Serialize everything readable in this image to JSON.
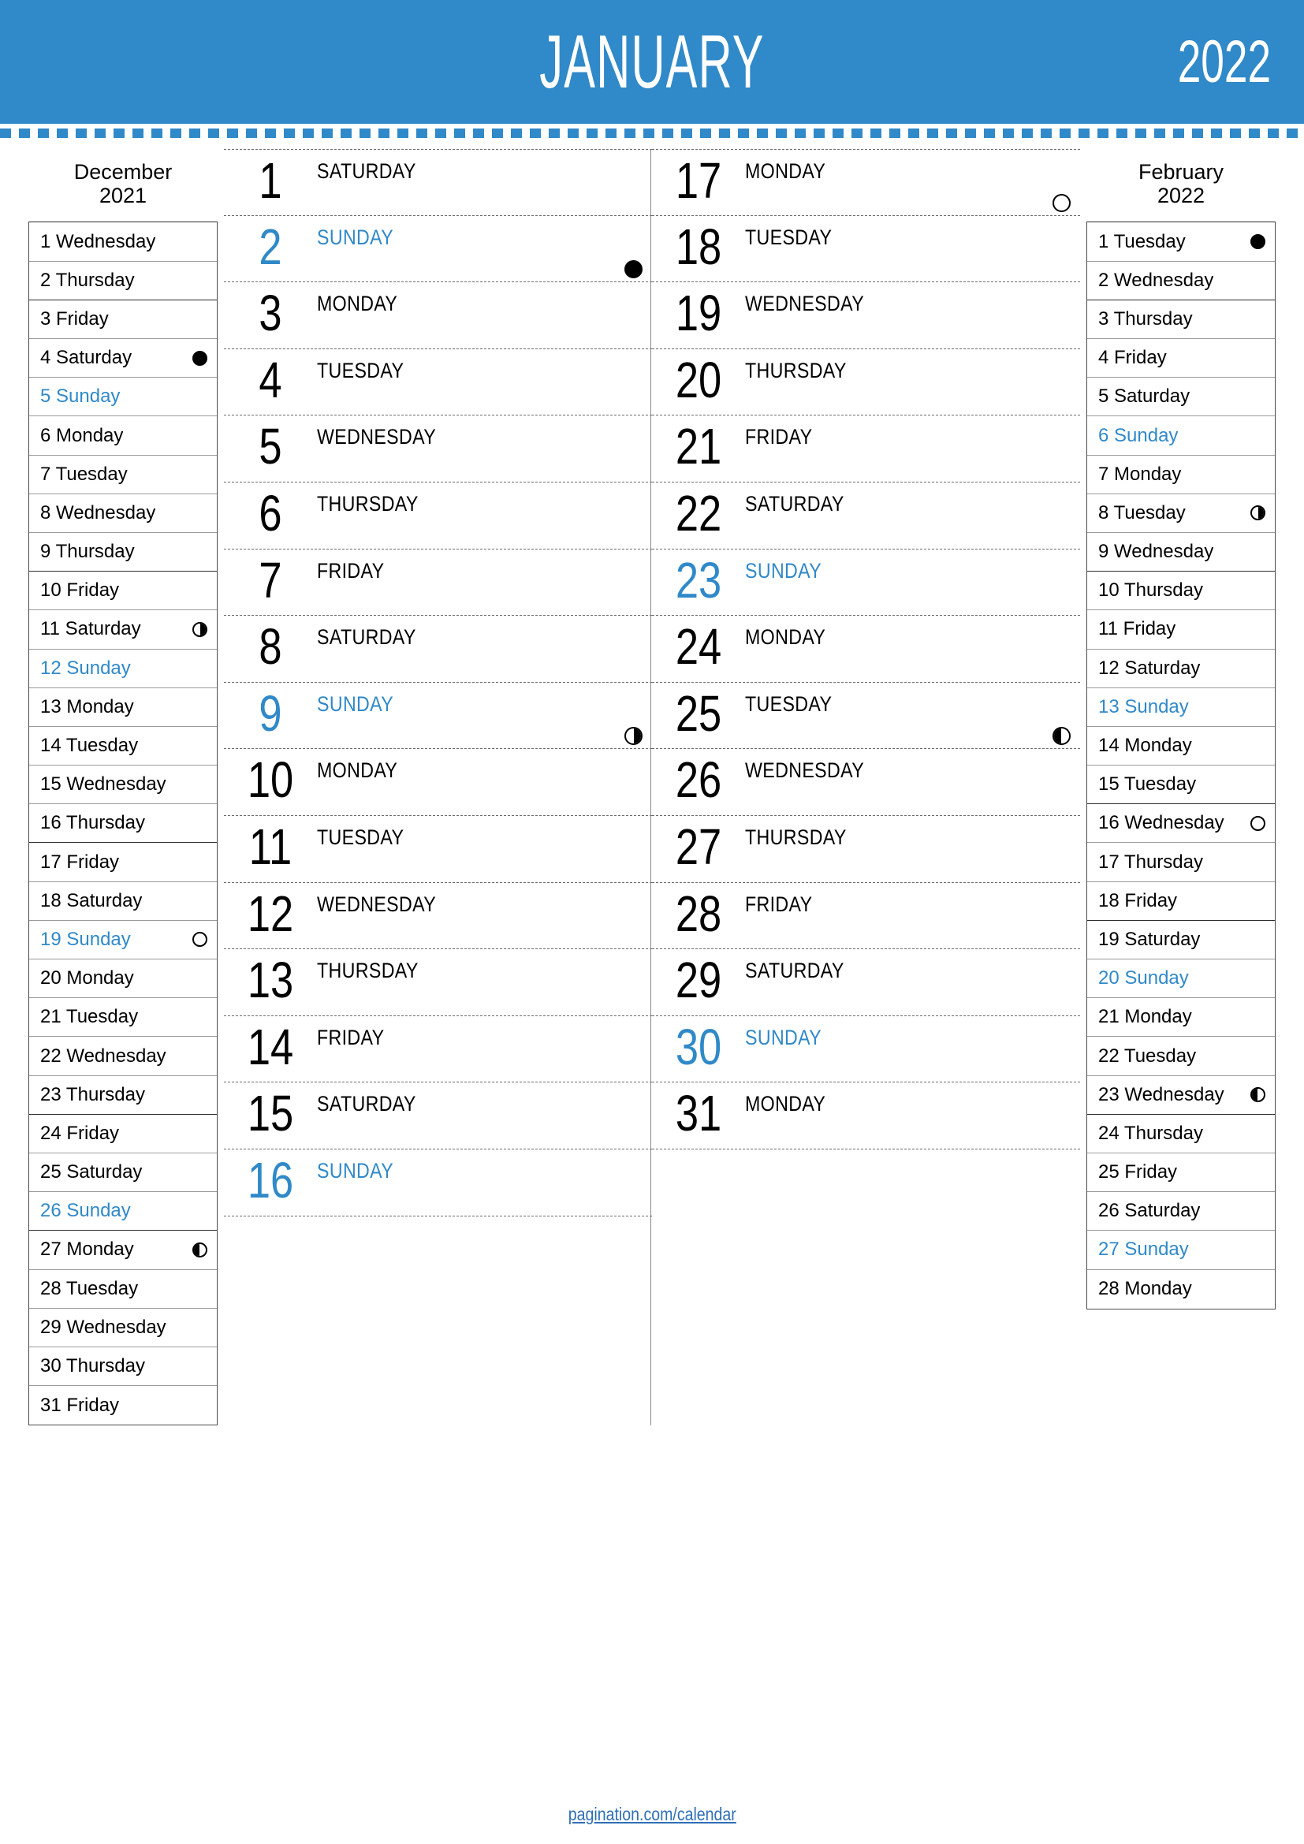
{
  "header": {
    "month": "JANUARY",
    "year": "2022",
    "accent_color": "#3089c8"
  },
  "footer": {
    "link_text": "pagination.com/calendar",
    "link_color": "#2f6fb5"
  },
  "moon_legend": {
    "new": "new-moon",
    "first": "first-quarter-moon",
    "full": "full-moon",
    "last": "last-quarter-moon"
  },
  "prev_month": {
    "name": "December",
    "year": "2021",
    "days": [
      {
        "num": "1",
        "weekday": "Wednesday",
        "label": "1 Wednesday",
        "sunday": false,
        "moon": "none",
        "week_end": false
      },
      {
        "num": "2",
        "weekday": "Thursday",
        "label": "2 Thursday",
        "sunday": false,
        "moon": "none",
        "week_end": true
      },
      {
        "num": "3",
        "weekday": "Friday",
        "label": "3 Friday",
        "sunday": false,
        "moon": "none",
        "week_end": false
      },
      {
        "num": "4",
        "weekday": "Saturday",
        "label": "4 Saturday",
        "sunday": false,
        "moon": "new",
        "week_end": false
      },
      {
        "num": "5",
        "weekday": "Sunday",
        "label": "5 Sunday",
        "sunday": true,
        "moon": "none",
        "week_end": false
      },
      {
        "num": "6",
        "weekday": "Monday",
        "label": "6 Monday",
        "sunday": false,
        "moon": "none",
        "week_end": false
      },
      {
        "num": "7",
        "weekday": "Tuesday",
        "label": "7 Tuesday",
        "sunday": false,
        "moon": "none",
        "week_end": false
      },
      {
        "num": "8",
        "weekday": "Wednesday",
        "label": "8 Wednesday",
        "sunday": false,
        "moon": "none",
        "week_end": false
      },
      {
        "num": "9",
        "weekday": "Thursday",
        "label": "9 Thursday",
        "sunday": false,
        "moon": "none",
        "week_end": true
      },
      {
        "num": "10",
        "weekday": "Friday",
        "label": "10 Friday",
        "sunday": false,
        "moon": "none",
        "week_end": false
      },
      {
        "num": "11",
        "weekday": "Saturday",
        "label": "11 Saturday",
        "sunday": false,
        "moon": "first",
        "week_end": false
      },
      {
        "num": "12",
        "weekday": "Sunday",
        "label": "12 Sunday",
        "sunday": true,
        "moon": "none",
        "week_end": false
      },
      {
        "num": "13",
        "weekday": "Monday",
        "label": "13 Monday",
        "sunday": false,
        "moon": "none",
        "week_end": false
      },
      {
        "num": "14",
        "weekday": "Tuesday",
        "label": "14 Tuesday",
        "sunday": false,
        "moon": "none",
        "week_end": false
      },
      {
        "num": "15",
        "weekday": "Wednesday",
        "label": "15 Wednesday",
        "sunday": false,
        "moon": "none",
        "week_end": false
      },
      {
        "num": "16",
        "weekday": "Thursday",
        "label": "16 Thursday",
        "sunday": false,
        "moon": "none",
        "week_end": true
      },
      {
        "num": "17",
        "weekday": "Friday",
        "label": "17 Friday",
        "sunday": false,
        "moon": "none",
        "week_end": false
      },
      {
        "num": "18",
        "weekday": "Saturday",
        "label": "18 Saturday",
        "sunday": false,
        "moon": "none",
        "week_end": false
      },
      {
        "num": "19",
        "weekday": "Sunday",
        "label": "19 Sunday",
        "sunday": true,
        "moon": "full",
        "week_end": false
      },
      {
        "num": "20",
        "weekday": "Monday",
        "label": "20 Monday",
        "sunday": false,
        "moon": "none",
        "week_end": false
      },
      {
        "num": "21",
        "weekday": "Tuesday",
        "label": "21 Tuesday",
        "sunday": false,
        "moon": "none",
        "week_end": false
      },
      {
        "num": "22",
        "weekday": "Wednesday",
        "label": "22 Wednesday",
        "sunday": false,
        "moon": "none",
        "week_end": false
      },
      {
        "num": "23",
        "weekday": "Thursday",
        "label": "23 Thursday",
        "sunday": false,
        "moon": "none",
        "week_end": true
      },
      {
        "num": "24",
        "weekday": "Friday",
        "label": "24 Friday",
        "sunday": false,
        "moon": "none",
        "week_end": false
      },
      {
        "num": "25",
        "weekday": "Saturday",
        "label": "25 Saturday",
        "sunday": false,
        "moon": "none",
        "week_end": false
      },
      {
        "num": "26",
        "weekday": "Sunday",
        "label": "26 Sunday",
        "sunday": true,
        "moon": "none",
        "week_end": true
      },
      {
        "num": "27",
        "weekday": "Monday",
        "label": "27 Monday",
        "sunday": false,
        "moon": "last",
        "week_end": false
      },
      {
        "num": "28",
        "weekday": "Tuesday",
        "label": "28 Tuesday",
        "sunday": false,
        "moon": "none",
        "week_end": false
      },
      {
        "num": "29",
        "weekday": "Wednesday",
        "label": "29 Wednesday",
        "sunday": false,
        "moon": "none",
        "week_end": false
      },
      {
        "num": "30",
        "weekday": "Thursday",
        "label": "30 Thursday",
        "sunday": false,
        "moon": "none",
        "week_end": false
      },
      {
        "num": "31",
        "weekday": "Friday",
        "label": "31 Friday",
        "sunday": false,
        "moon": "none",
        "week_end": false
      }
    ]
  },
  "next_month": {
    "name": "February",
    "year": "2022",
    "days": [
      {
        "num": "1",
        "weekday": "Tuesday",
        "label": "1 Tuesday",
        "sunday": false,
        "moon": "new",
        "week_end": false
      },
      {
        "num": "2",
        "weekday": "Wednesday",
        "label": "2 Wednesday",
        "sunday": false,
        "moon": "none",
        "week_end": true
      },
      {
        "num": "3",
        "weekday": "Thursday",
        "label": "3 Thursday",
        "sunday": false,
        "moon": "none",
        "week_end": false
      },
      {
        "num": "4",
        "weekday": "Friday",
        "label": "4 Friday",
        "sunday": false,
        "moon": "none",
        "week_end": false
      },
      {
        "num": "5",
        "weekday": "Saturday",
        "label": "5 Saturday",
        "sunday": false,
        "moon": "none",
        "week_end": false
      },
      {
        "num": "6",
        "weekday": "Sunday",
        "label": "6 Sunday",
        "sunday": true,
        "moon": "none",
        "week_end": false
      },
      {
        "num": "7",
        "weekday": "Monday",
        "label": "7 Monday",
        "sunday": false,
        "moon": "none",
        "week_end": false
      },
      {
        "num": "8",
        "weekday": "Tuesday",
        "label": "8 Tuesday",
        "sunday": false,
        "moon": "first",
        "week_end": false
      },
      {
        "num": "9",
        "weekday": "Wednesday",
        "label": "9 Wednesday",
        "sunday": false,
        "moon": "none",
        "week_end": true
      },
      {
        "num": "10",
        "weekday": "Thursday",
        "label": "10 Thursday",
        "sunday": false,
        "moon": "none",
        "week_end": false
      },
      {
        "num": "11",
        "weekday": "Friday",
        "label": "11 Friday",
        "sunday": false,
        "moon": "none",
        "week_end": false
      },
      {
        "num": "12",
        "weekday": "Saturday",
        "label": "12 Saturday",
        "sunday": false,
        "moon": "none",
        "week_end": false
      },
      {
        "num": "13",
        "weekday": "Sunday",
        "label": "13 Sunday",
        "sunday": true,
        "moon": "none",
        "week_end": false
      },
      {
        "num": "14",
        "weekday": "Monday",
        "label": "14 Monday",
        "sunday": false,
        "moon": "none",
        "week_end": false
      },
      {
        "num": "15",
        "weekday": "Tuesday",
        "label": "15 Tuesday",
        "sunday": false,
        "moon": "none",
        "week_end": true
      },
      {
        "num": "16",
        "weekday": "Wednesday",
        "label": "16 Wednesday",
        "sunday": false,
        "moon": "full",
        "week_end": false
      },
      {
        "num": "17",
        "weekday": "Thursday",
        "label": "17 Thursday",
        "sunday": false,
        "moon": "none",
        "week_end": false
      },
      {
        "num": "18",
        "weekday": "Friday",
        "label": "18 Friday",
        "sunday": false,
        "moon": "none",
        "week_end": true
      },
      {
        "num": "19",
        "weekday": "Saturday",
        "label": "19 Saturday",
        "sunday": false,
        "moon": "none",
        "week_end": false
      },
      {
        "num": "20",
        "weekday": "Sunday",
        "label": "20 Sunday",
        "sunday": true,
        "moon": "none",
        "week_end": false
      },
      {
        "num": "21",
        "weekday": "Monday",
        "label": "21 Monday",
        "sunday": false,
        "moon": "none",
        "week_end": false
      },
      {
        "num": "22",
        "weekday": "Tuesday",
        "label": "22 Tuesday",
        "sunday": false,
        "moon": "none",
        "week_end": false
      },
      {
        "num": "23",
        "weekday": "Wednesday",
        "label": "23 Wednesday",
        "sunday": false,
        "moon": "last",
        "week_end": true
      },
      {
        "num": "24",
        "weekday": "Thursday",
        "label": "24 Thursday",
        "sunday": false,
        "moon": "none",
        "week_end": false
      },
      {
        "num": "25",
        "weekday": "Friday",
        "label": "25 Friday",
        "sunday": false,
        "moon": "none",
        "week_end": false
      },
      {
        "num": "26",
        "weekday": "Saturday",
        "label": "26 Saturday",
        "sunday": false,
        "moon": "none",
        "week_end": false
      },
      {
        "num": "27",
        "weekday": "Sunday",
        "label": "27 Sunday",
        "sunday": true,
        "moon": "none",
        "week_end": false
      },
      {
        "num": "28",
        "weekday": "Monday",
        "label": "28 Monday",
        "sunday": false,
        "moon": "none",
        "week_end": false
      }
    ]
  },
  "month_column_left": [
    {
      "num": "1",
      "weekday": "SATURDAY",
      "sunday": false,
      "moon": "none"
    },
    {
      "num": "2",
      "weekday": "SUNDAY",
      "sunday": true,
      "moon": "new"
    },
    {
      "num": "3",
      "weekday": "MONDAY",
      "sunday": false,
      "moon": "none"
    },
    {
      "num": "4",
      "weekday": "TUESDAY",
      "sunday": false,
      "moon": "none"
    },
    {
      "num": "5",
      "weekday": "WEDNESDAY",
      "sunday": false,
      "moon": "none"
    },
    {
      "num": "6",
      "weekday": "THURSDAY",
      "sunday": false,
      "moon": "none"
    },
    {
      "num": "7",
      "weekday": "FRIDAY",
      "sunday": false,
      "moon": "none"
    },
    {
      "num": "8",
      "weekday": "SATURDAY",
      "sunday": false,
      "moon": "none"
    },
    {
      "num": "9",
      "weekday": "SUNDAY",
      "sunday": true,
      "moon": "first"
    },
    {
      "num": "10",
      "weekday": "MONDAY",
      "sunday": false,
      "moon": "none"
    },
    {
      "num": "11",
      "weekday": "TUESDAY",
      "sunday": false,
      "moon": "none"
    },
    {
      "num": "12",
      "weekday": "WEDNESDAY",
      "sunday": false,
      "moon": "none"
    },
    {
      "num": "13",
      "weekday": "THURSDAY",
      "sunday": false,
      "moon": "none"
    },
    {
      "num": "14",
      "weekday": "FRIDAY",
      "sunday": false,
      "moon": "none"
    },
    {
      "num": "15",
      "weekday": "SATURDAY",
      "sunday": false,
      "moon": "none"
    },
    {
      "num": "16",
      "weekday": "SUNDAY",
      "sunday": true,
      "moon": "none"
    }
  ],
  "month_column_right": [
    {
      "num": "17",
      "weekday": "MONDAY",
      "sunday": false,
      "moon": "full"
    },
    {
      "num": "18",
      "weekday": "TUESDAY",
      "sunday": false,
      "moon": "none"
    },
    {
      "num": "19",
      "weekday": "WEDNESDAY",
      "sunday": false,
      "moon": "none"
    },
    {
      "num": "20",
      "weekday": "THURSDAY",
      "sunday": false,
      "moon": "none"
    },
    {
      "num": "21",
      "weekday": "FRIDAY",
      "sunday": false,
      "moon": "none"
    },
    {
      "num": "22",
      "weekday": "SATURDAY",
      "sunday": false,
      "moon": "none"
    },
    {
      "num": "23",
      "weekday": "SUNDAY",
      "sunday": true,
      "moon": "none"
    },
    {
      "num": "24",
      "weekday": "MONDAY",
      "sunday": false,
      "moon": "none"
    },
    {
      "num": "25",
      "weekday": "TUESDAY",
      "sunday": false,
      "moon": "last"
    },
    {
      "num": "26",
      "weekday": "WEDNESDAY",
      "sunday": false,
      "moon": "none"
    },
    {
      "num": "27",
      "weekday": "THURSDAY",
      "sunday": false,
      "moon": "none"
    },
    {
      "num": "28",
      "weekday": "FRIDAY",
      "sunday": false,
      "moon": "none"
    },
    {
      "num": "29",
      "weekday": "SATURDAY",
      "sunday": false,
      "moon": "none"
    },
    {
      "num": "30",
      "weekday": "SUNDAY",
      "sunday": true,
      "moon": "none"
    },
    {
      "num": "31",
      "weekday": "MONDAY",
      "sunday": false,
      "moon": "none"
    }
  ]
}
